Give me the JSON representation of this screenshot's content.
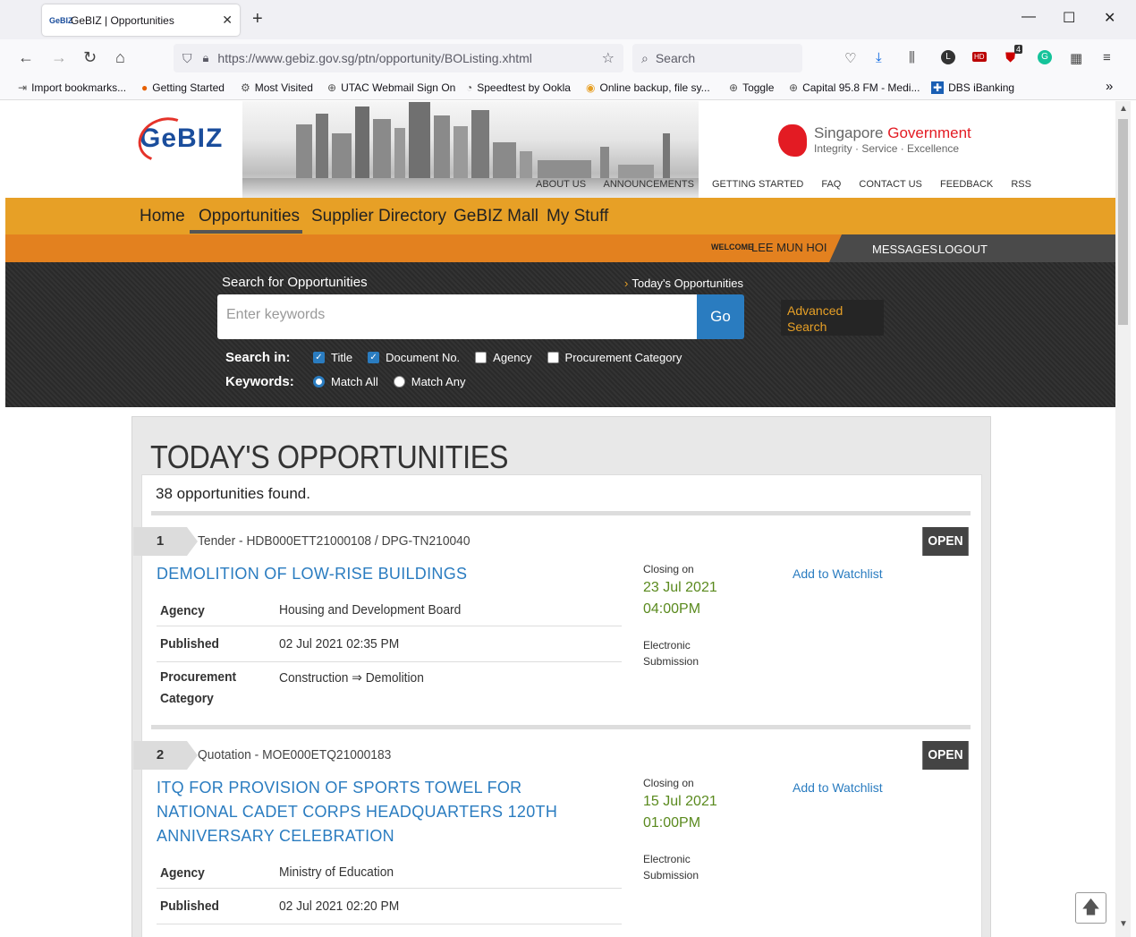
{
  "browser": {
    "tab_title": "GeBIZ | Opportunities",
    "tab_favicon_text": "GeBIZ",
    "url": "https://www.gebiz.gov.sg/ptn/opportunity/BOListing.xhtml",
    "search_placeholder": "Search",
    "badge_count": "4",
    "bookmarks": [
      {
        "icon": "import-icon",
        "label": "Import bookmarks..."
      },
      {
        "icon": "firefox-icon",
        "label": "Getting Started"
      },
      {
        "icon": "gear-icon",
        "label": "Most Visited"
      },
      {
        "icon": "globe-icon",
        "label": "UTAC Webmail Sign On"
      },
      {
        "icon": "speedtest-icon",
        "label": "Speedtest by Ookla"
      },
      {
        "icon": "backup-icon",
        "label": "Online backup, file sy..."
      },
      {
        "icon": "globe-icon",
        "label": "Toggle"
      },
      {
        "icon": "globe-icon",
        "label": "Capital 95.8 FM - Medi..."
      },
      {
        "icon": "dbs-icon",
        "label": "DBS iBanking"
      }
    ]
  },
  "site": {
    "logo": "GeBIZ",
    "gov_title_1": "Singapore ",
    "gov_title_2": "Government",
    "gov_tagline": "Integrity · Service · Excellence",
    "top_links": [
      "ABOUT US",
      "ANNOUNCEMENTS",
      "GETTING STARTED",
      "FAQ",
      "CONTACT US",
      "FEEDBACK",
      "RSS"
    ],
    "nav": [
      "Home",
      "Opportunities",
      "Supplier Directory",
      "GeBIZ Mall",
      "My Stuff"
    ],
    "welcome_label": "WELCOME",
    "welcome_name": "LEE MUN HOI",
    "messages": "MESSAGES",
    "logout": "LOGOUT"
  },
  "search": {
    "label": "Search for Opportunities",
    "todays_link": "Today's Opportunities",
    "placeholder": "Enter keywords",
    "go": "Go",
    "advanced": "Advanced Search",
    "search_in_label": "Search in:",
    "search_in": [
      {
        "label": "Title",
        "checked": true
      },
      {
        "label": "Document No.",
        "checked": true
      },
      {
        "label": "Agency",
        "checked": false
      },
      {
        "label": "Procurement Category",
        "checked": false
      }
    ],
    "keywords_label": "Keywords:",
    "keywords": [
      {
        "label": "Match All",
        "selected": true
      },
      {
        "label": "Match Any",
        "selected": false
      }
    ]
  },
  "listing": {
    "heading": "TODAY'S OPPORTUNITIES",
    "found": "38 opportunities found.",
    "items": [
      {
        "num": "1",
        "type": "Tender - HDB000ETT21000108 / DPG-TN210040",
        "status": "OPEN",
        "title": "DEMOLITION OF LOW-RISE BUILDINGS",
        "agency_label": "Agency",
        "agency": "Housing and Development Board",
        "published_label": "Published",
        "published": "02 Jul 2021 02:35 PM",
        "category_label_1": "Procurement",
        "category_label_2": "Category",
        "category": "Construction ⇒ Demolition",
        "closing_label": "Closing on",
        "closing_date": "23 Jul 2021",
        "closing_time": "04:00PM",
        "submission_1": "Electronic",
        "submission_2": "Submission",
        "watchlist": "Add to Watchlist"
      },
      {
        "num": "2",
        "type": "Quotation - MOE000ETQ21000183",
        "status": "OPEN",
        "title": "ITQ FOR PROVISION OF SPORTS TOWEL FOR NATIONAL CADET CORPS HEADQUARTERS 120TH ANNIVERSARY CELEBRATION",
        "agency_label": "Agency",
        "agency": "Ministry of Education",
        "published_label": "Published",
        "published": "02 Jul 2021 02:20 PM",
        "closing_label": "Closing on",
        "closing_date": "15 Jul 2021",
        "closing_time": "01:00PM",
        "submission_1": "Electronic",
        "submission_2": "Submission",
        "watchlist": "Add to Watchlist"
      }
    ]
  }
}
